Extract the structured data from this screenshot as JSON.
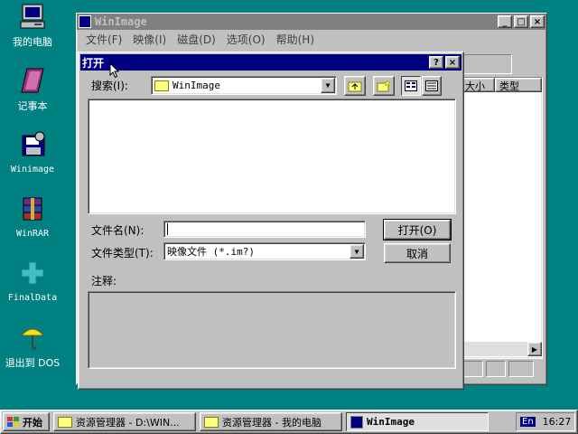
{
  "desktop": {
    "icons": [
      {
        "label": "我的电脑",
        "icon": "my-computer-icon"
      },
      {
        "label": "记事本",
        "icon": "notepad-icon"
      },
      {
        "label": "Winimage",
        "icon": "winimage-icon"
      },
      {
        "label": "WinRAR",
        "icon": "winrar-icon"
      },
      {
        "label": "FinalData",
        "icon": "finaldata-icon"
      },
      {
        "label": "退出到 DOS",
        "icon": "exit-dos-icon"
      }
    ]
  },
  "main_window": {
    "title": "WinImage",
    "menu": [
      "文件(F)",
      "映像(I)",
      "磁盘(D)",
      "选项(O)",
      "帮助(H)"
    ],
    "columns": [
      "大小",
      "类型"
    ]
  },
  "dialog": {
    "title": "打开",
    "help_button": "?",
    "close_button": "×",
    "search_label": "搜索(I):",
    "search_value": "WinImage",
    "filename_label": "文件名(N):",
    "filename_value": "",
    "filetype_label": "文件类型(T):",
    "filetype_value": "映像文件 (*.im?)",
    "open_button": "打开(O)",
    "cancel_button": "取消",
    "comment_label": "注释:"
  },
  "taskbar": {
    "start_label": "开始",
    "tasks": [
      {
        "label": "资源管理器 - D:\\WIN..."
      },
      {
        "label": "资源管理器 - 我的电脑"
      },
      {
        "label": "WinImage"
      }
    ],
    "language": "En",
    "clock": "16:27"
  },
  "colors": {
    "desktop": "#008080",
    "face": "#c0c0c0",
    "active_title": "#000080",
    "inactive_title": "#808080"
  }
}
